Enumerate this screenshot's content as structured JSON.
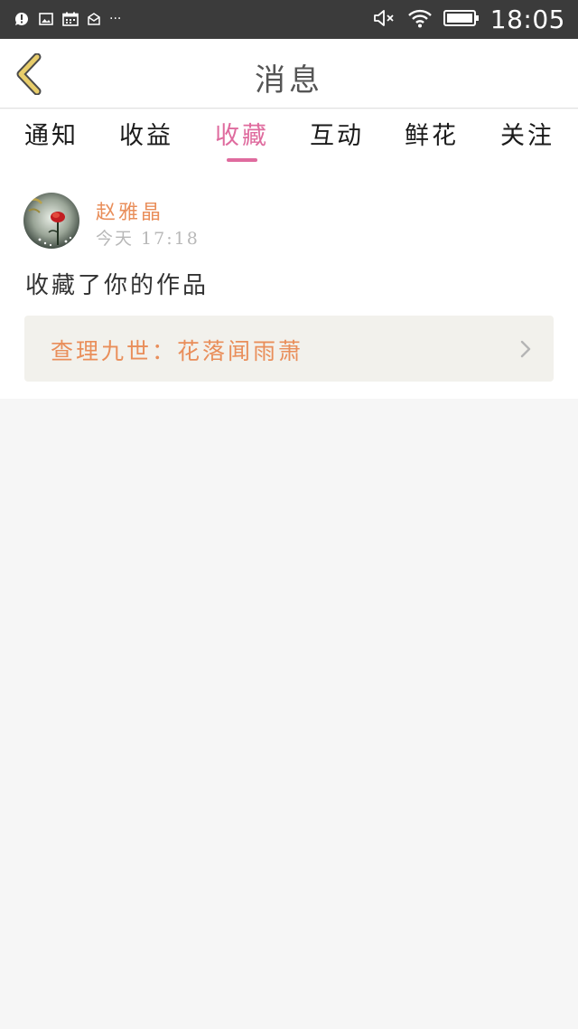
{
  "status_bar": {
    "time": "18:05",
    "left_icons": [
      "chat-notification-icon",
      "image-icon",
      "calendar-icon",
      "mail-icon",
      "more-dots-icon"
    ],
    "right_icons": [
      "mute-icon",
      "wifi-icon",
      "battery-icon"
    ],
    "more_dots": "···"
  },
  "nav": {
    "title": "消息",
    "back_icon": "chevron-left-icon"
  },
  "tabs": [
    {
      "label": "通知",
      "active": false
    },
    {
      "label": "收益",
      "active": false
    },
    {
      "label": "收藏",
      "active": true
    },
    {
      "label": "互动",
      "active": false
    },
    {
      "label": "鲜花",
      "active": false
    },
    {
      "label": "关注",
      "active": false
    }
  ],
  "message": {
    "sender": "赵雅晶",
    "time": "今天 17:18",
    "text": "收藏了你的作品",
    "work_title": "查理九世：花落闻雨萧",
    "link_icon": "chevron-right-icon"
  },
  "colors": {
    "status_bar_bg": "#3b3b3b",
    "accent_pink": "#df6b9e",
    "accent_orange": "#e98e5a",
    "back_icon": "#e8cd6a",
    "page_bg": "#f6f6f6",
    "link_bg": "#f2f1ec"
  }
}
